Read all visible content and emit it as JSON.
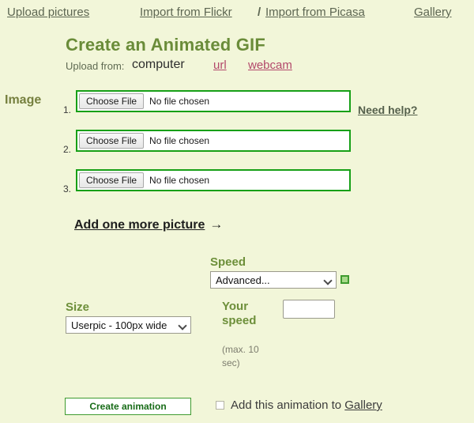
{
  "nav": {
    "items": [
      {
        "label": "Upload pictures"
      },
      {
        "label": "Import from Flickr"
      },
      {
        "label": "Import from Picasa"
      },
      {
        "label": "Gallery"
      }
    ],
    "separator": "/"
  },
  "header": {
    "title": "Create an Animated GIF",
    "upload_from_label": "Upload from:",
    "upload_from_current": "computer",
    "upload_from_options": [
      {
        "label": "url"
      },
      {
        "label": "webcam"
      }
    ]
  },
  "image_section": {
    "label": "Image",
    "need_help": "Need help?",
    "add_more_text": "Add one more picture",
    "add_more_arrow": "→",
    "rows": [
      {
        "index": "1.",
        "button_label": "Choose File",
        "status": "No file chosen"
      },
      {
        "index": "2.",
        "button_label": "Choose File",
        "status": "No file chosen"
      },
      {
        "index": "3.",
        "button_label": "Choose File",
        "status": "No file chosen"
      }
    ]
  },
  "speed": {
    "heading": "Speed",
    "selected": "Advanced...",
    "indicator_icon": "green-square-icon",
    "indicator_color": "#a8d98a",
    "your_speed_heading": "Your speed",
    "your_speed_value": "",
    "your_speed_placeholder": "",
    "max_note": "(max. 10 sec)"
  },
  "size": {
    "heading": "Size",
    "selected": "Userpic - 100px wide"
  },
  "actions": {
    "create_label": "Create animation",
    "gallery_checkbox_checked": false,
    "gallery_text_prefix": "Add this animation to ",
    "gallery_link": "Gallery"
  },
  "colors": {
    "page_background": "#f2f6d9",
    "heading_green": "#6a8c39",
    "link_crimson": "#b3496b",
    "field_border_green": "#17a017",
    "button_green": "#176b17"
  }
}
